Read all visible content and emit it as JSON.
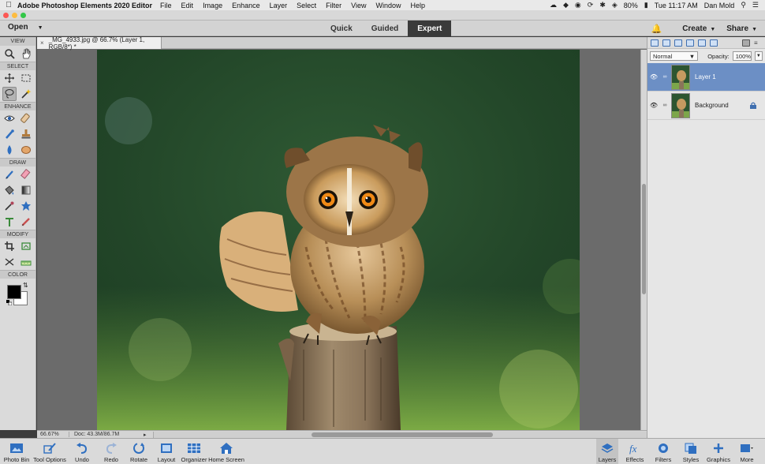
{
  "menubar": {
    "app_name": "Adobe Photoshop Elements 2020 Editor",
    "items": [
      "File",
      "Edit",
      "Image",
      "Enhance",
      "Layer",
      "Select",
      "Filter",
      "View",
      "Window",
      "Help"
    ],
    "battery": "80%",
    "clock": "Tue 11:17 AM",
    "user": "Dan Mold"
  },
  "topbar": {
    "open_label": "Open",
    "modes": [
      "Quick",
      "Guided",
      "Expert"
    ],
    "active_mode": "Expert",
    "create_label": "Create",
    "share_label": "Share"
  },
  "toolbox": {
    "sections": [
      "VIEW",
      "SELECT",
      "ENHANCE",
      "DRAW",
      "MODIFY",
      "COLOR"
    ],
    "foreground_color": "#000000",
    "background_color": "#ffffff"
  },
  "document": {
    "tab_title": "_MG_4933.jpg @ 66.7% (Layer 1, RGB/8*) *",
    "zoom": "66.67%",
    "doc_size": "Doc: 43.3M/86.7M"
  },
  "layers_panel": {
    "blend_mode": "Normal",
    "opacity_label": "Opacity:",
    "opacity_value": "100%",
    "layers": [
      {
        "name": "Layer 1",
        "selected": true
      },
      {
        "name": "Background",
        "selected": false
      }
    ]
  },
  "dock": {
    "left": [
      "Photo Bin",
      "Tool Options",
      "Undo",
      "Redo",
      "Rotate",
      "Layout",
      "Organizer",
      "Home Screen"
    ],
    "right": [
      "Layers",
      "Effects",
      "Filters",
      "Styles",
      "Graphics",
      "More"
    ]
  },
  "colors": {
    "accent": "#6c8fc5",
    "mode_active_bg": "#3a3a3a"
  }
}
